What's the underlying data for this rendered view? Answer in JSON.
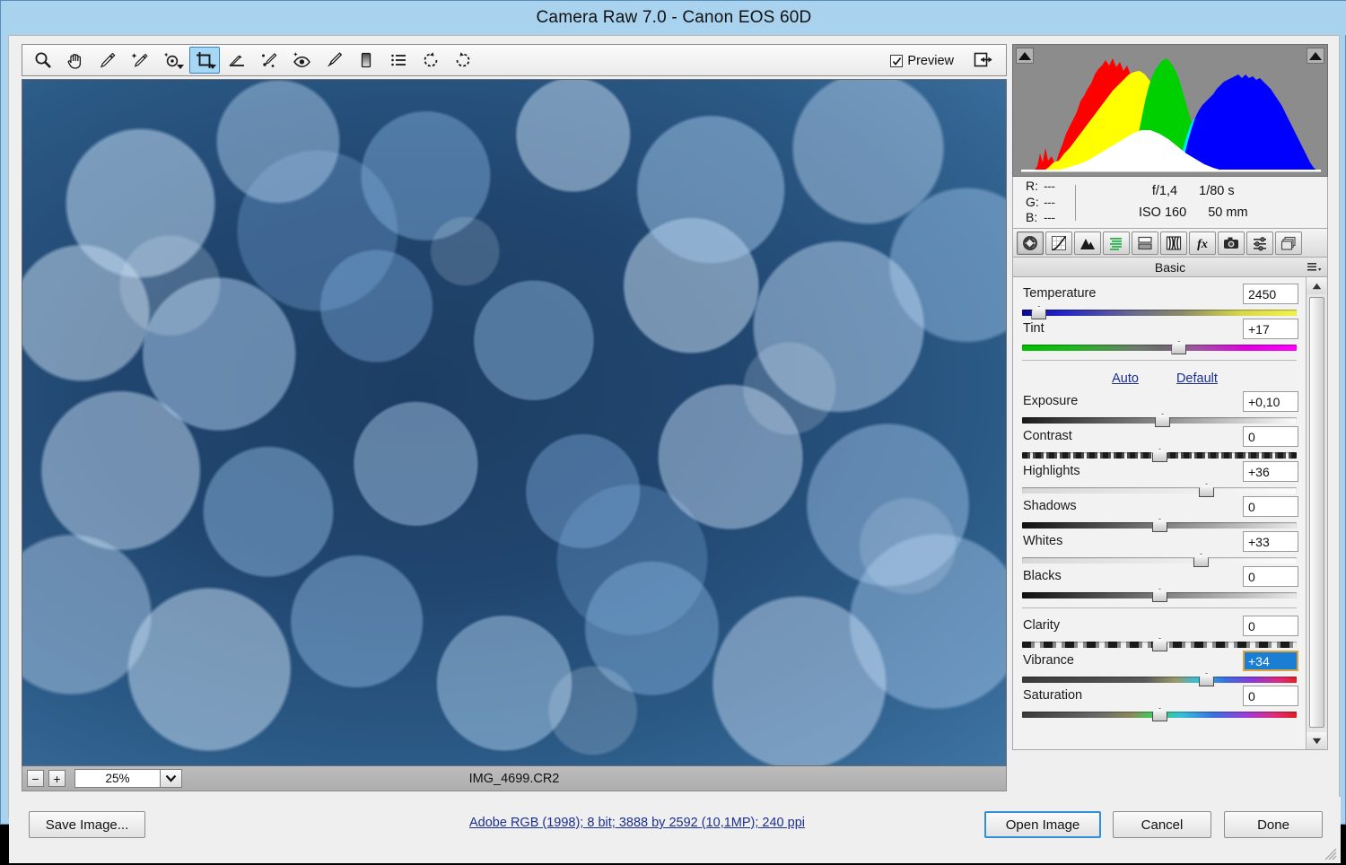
{
  "window": {
    "title": "Camera Raw 7.0  -  Canon EOS 60D"
  },
  "toolbar": {
    "tools": [
      {
        "name": "zoom-tool",
        "label": "Zoom Tool"
      },
      {
        "name": "hand-tool",
        "label": "Hand Tool"
      },
      {
        "name": "white-balance-tool",
        "label": "White Balance Tool"
      },
      {
        "name": "color-sampler-tool",
        "label": "Color Sampler Tool"
      },
      {
        "name": "targeted-adjustment-tool",
        "label": "Targeted Adjustment Tool"
      },
      {
        "name": "crop-tool",
        "label": "Crop Tool"
      },
      {
        "name": "straighten-tool",
        "label": "Straighten Tool"
      },
      {
        "name": "spot-removal-tool",
        "label": "Spot Removal"
      },
      {
        "name": "red-eye-removal-tool",
        "label": "Red Eye Removal"
      },
      {
        "name": "adjustment-brush-tool",
        "label": "Adjustment Brush"
      },
      {
        "name": "graduated-filter-tool",
        "label": "Graduated Filter"
      },
      {
        "name": "presets-tool",
        "label": "Open Preferences Dialog"
      },
      {
        "name": "rotate-ccw-tool",
        "label": "Rotate Image 90 Counter Clockwise"
      },
      {
        "name": "rotate-cw-tool",
        "label": "Rotate Image 90 Clockwise"
      }
    ],
    "active_tool": "crop-tool",
    "preview_label": "Preview",
    "preview_checked": true,
    "fullscreen_label": "Toggle Full Screen Mode"
  },
  "image": {
    "filename": "IMG_4699.CR2",
    "zoom_level": "25%",
    "zoom_out_label": "−",
    "zoom_in_label": "+"
  },
  "histogram": {
    "shadow_clipping_label": "Shadow clipping warning",
    "highlight_clipping_label": "Highlight clipping warning",
    "colors": {
      "red": "#ff0000",
      "yellow": "#ffff00",
      "green": "#00d000",
      "cyan": "#00e8ff",
      "blue": "#0000ff",
      "white": "#ffffff",
      "background": "#8c8c8c"
    }
  },
  "readout": {
    "channels": [
      {
        "label": "R:",
        "value": "---"
      },
      {
        "label": "G:",
        "value": "---"
      },
      {
        "label": "B:",
        "value": "---"
      }
    ],
    "aperture": "f/1,4",
    "shutter": "1/80 s",
    "iso": "ISO 160",
    "focal_length": "50 mm"
  },
  "panel": {
    "tabs": [
      {
        "name": "tab-basic",
        "label": "Basic",
        "active": true
      },
      {
        "name": "tab-tone-curve",
        "label": "Tone Curve",
        "active": false
      },
      {
        "name": "tab-detail",
        "label": "Detail",
        "active": false
      },
      {
        "name": "tab-hsl-grayscale",
        "label": "HSL / Grayscale",
        "active": false
      },
      {
        "name": "tab-split-toning",
        "label": "Split Toning",
        "active": false
      },
      {
        "name": "tab-lens-corrections",
        "label": "Lens Corrections",
        "active": false
      },
      {
        "name": "tab-effects",
        "label": "Effects",
        "active": false
      },
      {
        "name": "tab-camera-calibration",
        "label": "Camera Calibration",
        "active": false
      },
      {
        "name": "tab-presets",
        "label": "Presets",
        "active": false
      },
      {
        "name": "tab-snapshots",
        "label": "Snapshots",
        "active": false
      }
    ],
    "title": "Basic",
    "menu_label": "Panel Menu",
    "auto_label": "Auto",
    "default_label": "Default",
    "sliders": [
      {
        "name": "temperature",
        "label": "Temperature",
        "value": "2450",
        "pos": 6,
        "grad": "grad-temp",
        "selected": false
      },
      {
        "name": "tint",
        "label": "Tint",
        "value": "+17",
        "pos": 57,
        "grad": "grad-tint",
        "selected": false
      },
      {
        "name": "exposure",
        "label": "Exposure",
        "value": "+0,10",
        "pos": 51,
        "grad": "grad-gray",
        "selected": false
      },
      {
        "name": "contrast",
        "label": "Contrast",
        "value": "0",
        "pos": 50,
        "grad": "grad-contrast",
        "selected": false
      },
      {
        "name": "highlights",
        "label": "Highlights",
        "value": "+36",
        "pos": 67,
        "grad": "grad-light",
        "selected": false
      },
      {
        "name": "shadows",
        "label": "Shadows",
        "value": "0",
        "pos": 50,
        "grad": "grad-dark",
        "selected": false
      },
      {
        "name": "whites",
        "label": "Whites",
        "value": "+33",
        "pos": 65,
        "grad": "grad-light",
        "selected": false
      },
      {
        "name": "blacks",
        "label": "Blacks",
        "value": "0",
        "pos": 50,
        "grad": "grad-dark",
        "selected": false
      },
      {
        "name": "clarity",
        "label": "Clarity",
        "value": "0",
        "pos": 50,
        "grad": "grad-clarity",
        "selected": false
      },
      {
        "name": "vibrance",
        "label": "Vibrance",
        "value": "+34",
        "pos": 67,
        "grad": "grad-vib",
        "selected": true
      },
      {
        "name": "saturation",
        "label": "Saturation",
        "value": "0",
        "pos": 50,
        "grad": "grad-sat",
        "selected": false
      }
    ]
  },
  "bottom": {
    "save_label": "Save Image...",
    "info_link": "Adobe RGB (1998); 8 bit; 3888 by 2592 (10,1MP); 240 ppi",
    "open_label": "Open Image",
    "cancel_label": "Cancel",
    "done_label": "Done"
  }
}
